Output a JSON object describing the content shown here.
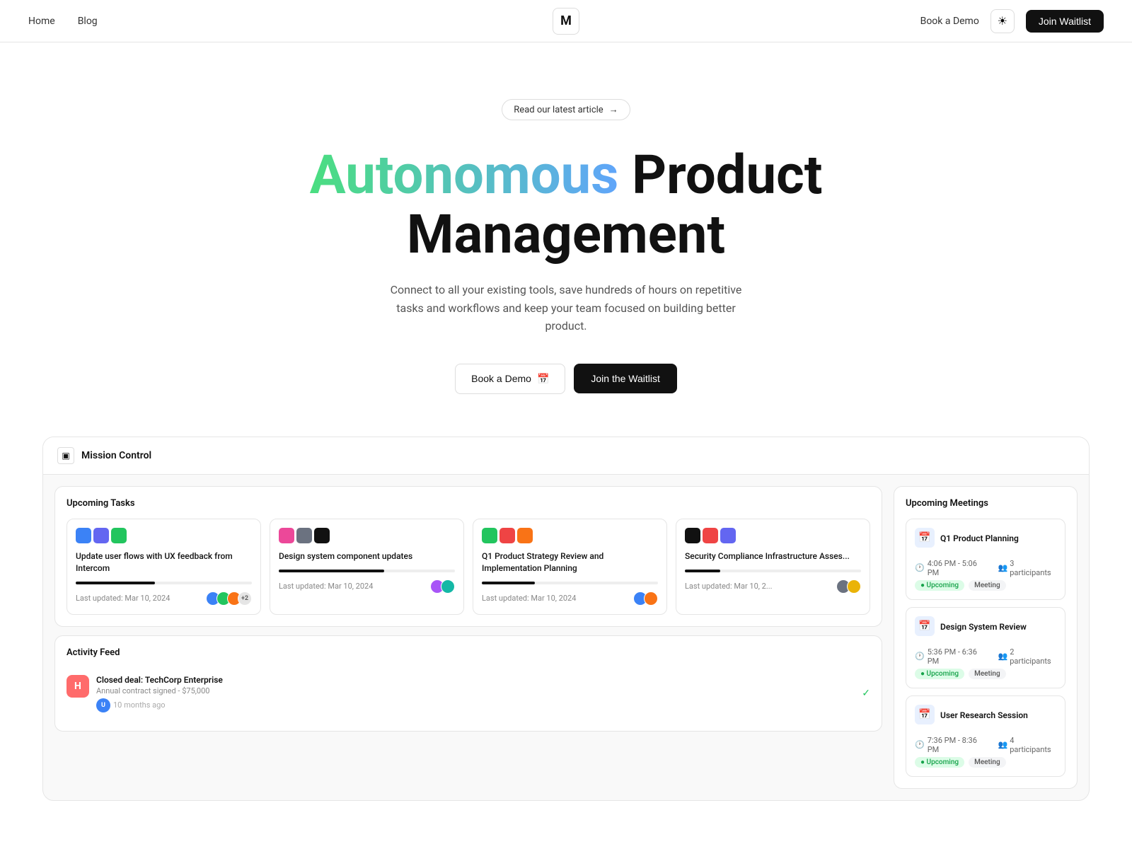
{
  "nav": {
    "home_label": "Home",
    "blog_label": "Blog",
    "logo_text": "M",
    "book_demo_label": "Book a Demo",
    "theme_icon": "☀",
    "join_waitlist_label": "Join Waitlist"
  },
  "hero": {
    "article_badge": "Read our latest article",
    "article_arrow": "→",
    "title_part1": "Autonomous",
    "title_part2": "Product",
    "title_line2": "Management",
    "subtitle": "Connect to all your existing tools, save hundreds of hours on repetitive tasks and workflows and keep your team focused on building better product.",
    "btn_demo": "Book a Demo",
    "btn_demo_icon": "📅",
    "btn_waitlist": "Join the Waitlist"
  },
  "dashboard": {
    "header_icon": "▣",
    "header_title": "Mission Control",
    "tasks": {
      "panel_title": "Upcoming Tasks",
      "items": [
        {
          "title": "Update user flows with UX feedback from Intercom",
          "progress": 45,
          "last_updated": "Last updated: Mar 10, 2024",
          "avatars": [
            "#3b82f6",
            "#22c55e",
            "#f97316"
          ],
          "extra_count": "+2",
          "icons": [
            "#3b82f6",
            "#6366f1",
            "#22c55e"
          ]
        },
        {
          "title": "Design system component updates",
          "progress": 60,
          "last_updated": "Last updated: Mar 10, 2024",
          "avatars": [
            "#a855f7",
            "#14b8a6"
          ],
          "extra_count": "",
          "icons": [
            "#ec4899",
            "#6b7280",
            "#111"
          ]
        },
        {
          "title": "Q1 Product Strategy Review and Implementation Planning",
          "progress": 30,
          "last_updated": "Last updated: Mar 10, 2024",
          "avatars": [
            "#3b82f6",
            "#f97316"
          ],
          "extra_count": "",
          "icons": [
            "#22c55e",
            "#ef4444",
            "#f97316"
          ]
        },
        {
          "title": "Security Compliance Infrastructure Asses...",
          "progress": 20,
          "last_updated": "Last updated: Mar 10, 2...",
          "avatars": [
            "#6b7280",
            "#eab308"
          ],
          "extra_count": "",
          "icons": [
            "#111",
            "#ef4444",
            "#6366f1"
          ]
        }
      ]
    },
    "activity": {
      "panel_title": "Activity Feed",
      "items": [
        {
          "logo_bg": "#ff6b6b",
          "logo_text": "H",
          "title": "Closed deal: TechCorp Enterprise",
          "sub": "Annual contract signed - $75,000",
          "time": "10 months ago",
          "check": true,
          "avatar_bg": "#3b82f6",
          "avatar_text": "U"
        }
      ]
    },
    "meetings": {
      "panel_title": "Upcoming Meetings",
      "items": [
        {
          "icon": "📅",
          "icon_bg": "#e8f0fe",
          "title": "Q1 Product Planning",
          "time": "4:06 PM - 5:06 PM",
          "participants": "3 participants",
          "tag_status": "Upcoming",
          "tag_type": "Meeting"
        },
        {
          "icon": "📅",
          "icon_bg": "#e8f0fe",
          "title": "Design System Review",
          "time": "5:36 PM - 6:36 PM",
          "participants": "2 participants",
          "tag_status": "Upcoming",
          "tag_type": "Meeting"
        },
        {
          "icon": "📅",
          "icon_bg": "#e8f0fe",
          "title": "User Research Session",
          "time": "7:36 PM - 8:36 PM",
          "participants": "4 participants",
          "tag_status": "Upcoming",
          "tag_type": "Meeting"
        }
      ]
    }
  }
}
